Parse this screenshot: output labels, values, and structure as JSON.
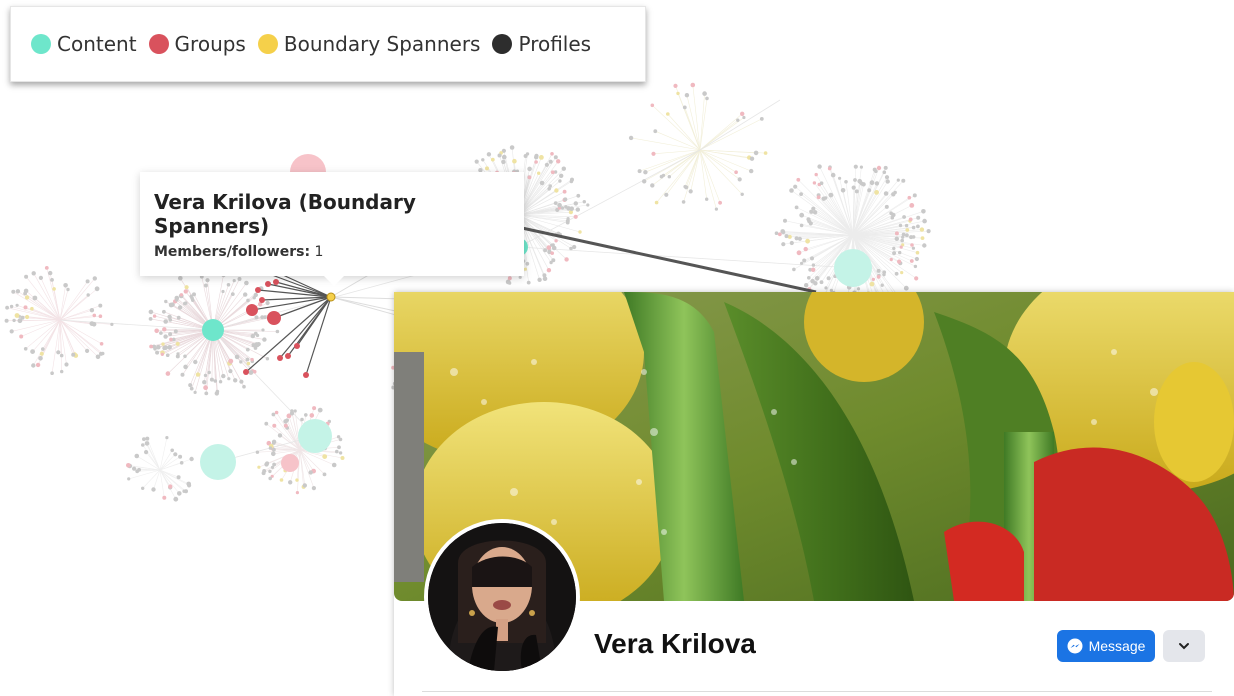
{
  "legend": {
    "items": [
      {
        "label": "Content",
        "color": "#6ee6cb"
      },
      {
        "label": "Groups",
        "color": "#d9525d"
      },
      {
        "label": "Boundary Spanners",
        "color": "#f5d04a"
      },
      {
        "label": "Profiles",
        "color": "#2d2d2d"
      }
    ]
  },
  "tooltip": {
    "title": "Vera Krilova (Boundary Spanners)",
    "members_label": "Members/followers:",
    "members_value": "1"
  },
  "profile": {
    "name": "Vera Krilova",
    "message_button": "Message",
    "icons": {
      "message": "messenger-icon",
      "more": "chevron-down-icon"
    },
    "colors": {
      "button": "#1b74e4",
      "secondary": "#e4e6eb"
    }
  }
}
